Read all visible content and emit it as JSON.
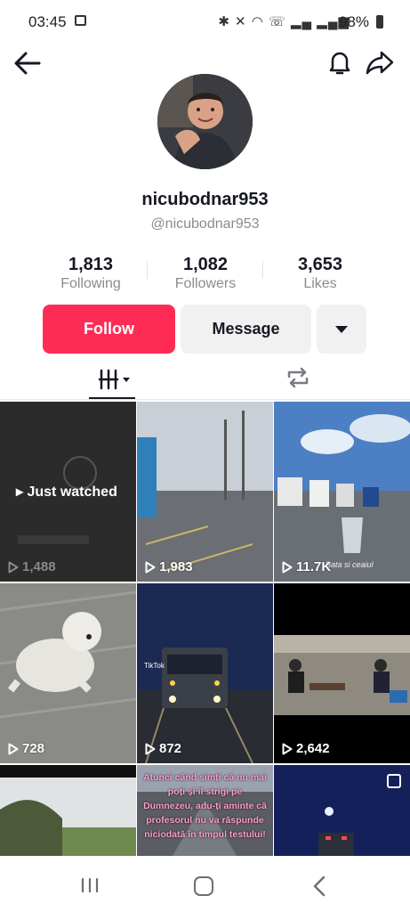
{
  "status": {
    "time": "03:45",
    "battery": "98%"
  },
  "profile": {
    "username": "nicubodnar953",
    "handle": "@nicubodnar953"
  },
  "stats": [
    {
      "value": "1,813",
      "label": "Following"
    },
    {
      "value": "1,082",
      "label": "Followers"
    },
    {
      "value": "3,653",
      "label": "Likes"
    }
  ],
  "actions": {
    "follow": "Follow",
    "message": "Message"
  },
  "videos": [
    {
      "views": "1,488",
      "badge": "Just watched"
    },
    {
      "views": "1,983"
    },
    {
      "views": "11.7K",
      "caption": "Bata si ceaiul"
    },
    {
      "views": "728"
    },
    {
      "views": "872",
      "watermark": "TikTok"
    },
    {
      "views": "2,642"
    },
    {
      "views": ""
    },
    {
      "views": "",
      "overlay": "Atunci când simți că nu mai poți și îl strigi pe Dumnezeu, adu-ți aminte că profesorul nu va răspunde niciodată în timpul testului!"
    },
    {
      "views": ""
    }
  ]
}
